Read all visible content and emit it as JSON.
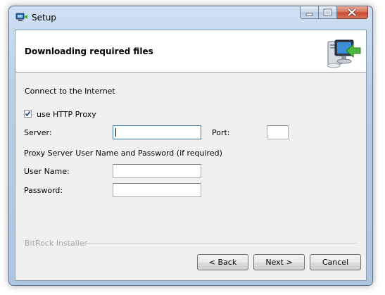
{
  "window": {
    "title": "Setup"
  },
  "header": {
    "title": "Downloading required files"
  },
  "section": {
    "connect_label": "Connect to the Internet",
    "use_proxy_label": "use HTTP Proxy",
    "use_proxy_checked": true,
    "server_label": "Server:",
    "server_value": "",
    "port_label": "Port:",
    "port_value": "",
    "credentials_label": "Proxy Server User Name and Password (if required)",
    "username_label": "User Name:",
    "username_value": "",
    "password_label": "Password:",
    "password_value": ""
  },
  "footer": {
    "brand": "BitRock Installer",
    "back_label": "< Back",
    "next_label": "Next >",
    "cancel_label": "Cancel"
  },
  "icons": {
    "title_icon": "setup-computer-icon",
    "header_icon": "download-computer-icon"
  },
  "colors": {
    "client_bg": "#f0f0f0",
    "header_bg": "#ffffff",
    "close_button": "#c7452c",
    "focus_border": "#3d7bad"
  }
}
